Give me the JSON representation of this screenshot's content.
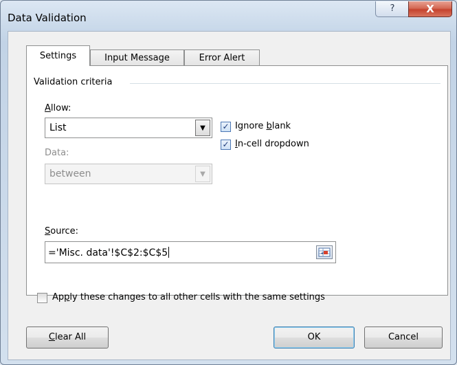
{
  "window": {
    "title": "Data Validation",
    "help_glyph": "?",
    "close_glyph": "X"
  },
  "tabs": [
    {
      "label": "Settings",
      "active": true
    },
    {
      "label": "Input Message",
      "active": false
    },
    {
      "label": "Error Alert",
      "active": false
    }
  ],
  "settings": {
    "group_label": "Validation criteria",
    "allow": {
      "label_mnemonic": "A",
      "label_rest": "llow:",
      "value": "List"
    },
    "data": {
      "label": "Data:",
      "value": "between",
      "enabled": false
    },
    "ignore_blank": {
      "label_pre": "Ignore ",
      "label_mnemonic": "b",
      "label_post": "lank",
      "checked": true
    },
    "incell_dropdown": {
      "label_mnemonic": "I",
      "label_rest": "n-cell dropdown",
      "checked": true
    },
    "source": {
      "label_mnemonic": "S",
      "label_rest": "ource:",
      "value": "='Misc. data'!$C$2:$C$5"
    },
    "apply_all": {
      "label_pre": "Ap",
      "label_mnemonic": "p",
      "label_post": "ly these changes to all other cells with the same settings",
      "checked": false
    }
  },
  "buttons": {
    "clear_all": {
      "label_mnemonic": "C",
      "label_rest": "lear All"
    },
    "ok": "OK",
    "cancel": "Cancel"
  },
  "icons": {
    "dropdown": "dropdown-arrow-icon",
    "check": "checkmark-icon",
    "range_ref": "collapse-dialog-icon"
  }
}
